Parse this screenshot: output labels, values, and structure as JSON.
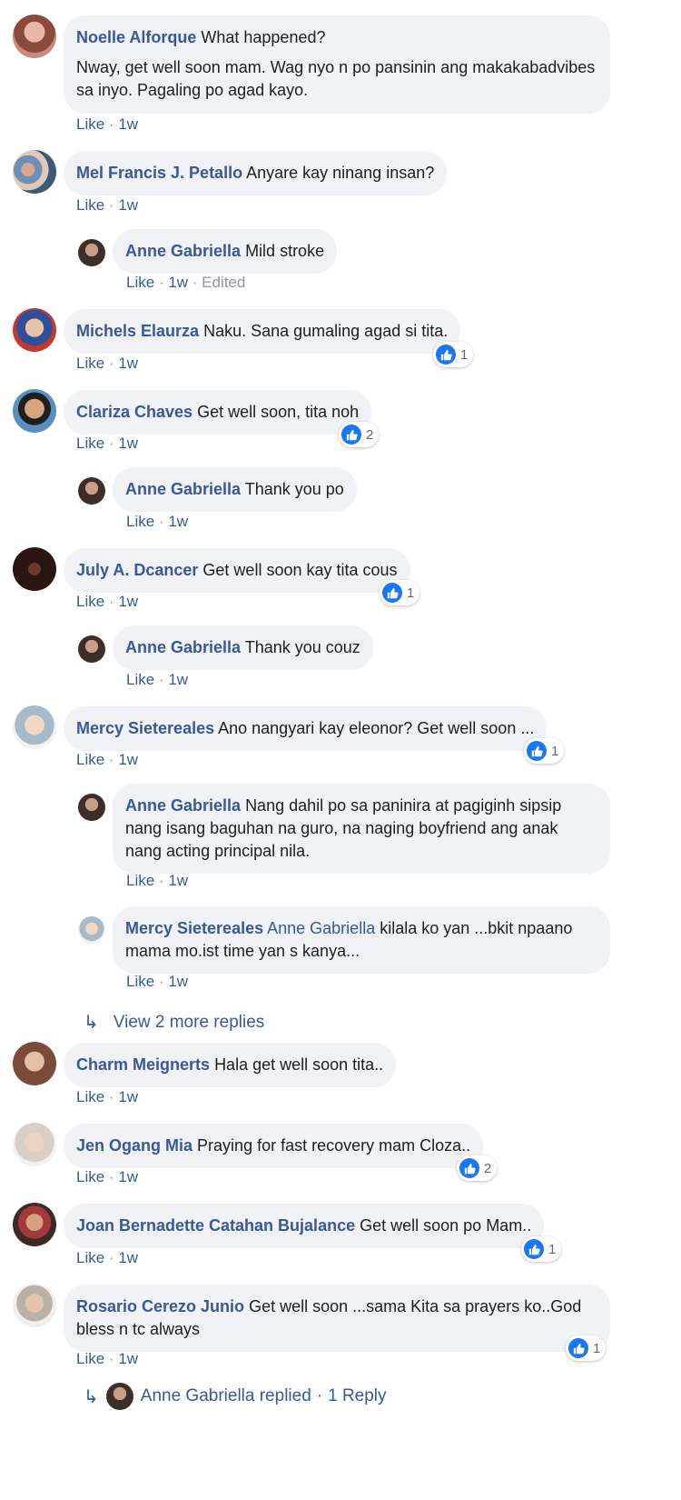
{
  "comments": [
    {
      "name": "Noelle Alforque",
      "text": "What happened?",
      "text2": "Nway, get well soon mam. Wag nyo n po pansinin ang makakabadvibes sa inyo. Pagaling po agad kayo.",
      "like": "Like",
      "time": "1w"
    },
    {
      "name": "Mel Francis J. Petallo",
      "text": "Anyare kay ninang insan?",
      "like": "Like",
      "time": "1w"
    },
    {
      "name": "Anne Gabriella",
      "text": "Mild stroke",
      "like": "Like",
      "time": "1w",
      "edited": "Edited"
    },
    {
      "name": "Michels Elaurza",
      "text": "Naku. Sana gumaling agad si tita.",
      "like": "Like",
      "time": "1w",
      "reactions": "1"
    },
    {
      "name": "Clariza Chaves",
      "text": "Get well soon, tita noh",
      "like": "Like",
      "time": "1w",
      "reactions": "2"
    },
    {
      "name": "Anne Gabriella",
      "text": "Thank you po",
      "like": "Like",
      "time": "1w"
    },
    {
      "name": "July A. Dcancer",
      "text": "Get well soon kay tita cous",
      "like": "Like",
      "time": "1w",
      "reactions": "1"
    },
    {
      "name": "Anne Gabriella",
      "text": "Thank you couz",
      "like": "Like",
      "time": "1w"
    },
    {
      "name": "Mercy Sietereales",
      "text": "Ano nangyari kay eleonor? Get well soon ...",
      "like": "Like",
      "time": "1w",
      "reactions": "1"
    },
    {
      "name": "Anne Gabriella",
      "text": "Nang dahil po sa paninira at pagiginh sipsip nang isang baguhan na guro, na naging boyfriend ang anak nang acting principal nila.",
      "like": "Like",
      "time": "1w"
    },
    {
      "name": "Mercy Sietereales",
      "tag": "Anne Gabriella",
      "text": "kilala ko yan ...bkit npaano mama mo.ist time yan s kanya...",
      "like": "Like",
      "time": "1w"
    },
    {
      "name": "Charm Meignerts",
      "text": "Hala get well soon tita..",
      "like": "Like",
      "time": "1w"
    },
    {
      "name": "Jen Ogang Mia",
      "text": "Praying for fast recovery mam Cloza..",
      "like": "Like",
      "time": "1w",
      "reactions": "2"
    },
    {
      "name": "Joan Bernadette Catahan Bujalance",
      "text": "Get well soon po Mam..",
      "like": "Like",
      "time": "1w",
      "reactions": "1"
    },
    {
      "name": "Rosario Cerezo Junio",
      "text": "Get well soon ...sama Kita sa prayers ko..God bless n tc always",
      "like": "Like",
      "time": "1w",
      "reactions": "1"
    }
  ],
  "view_more": "View 2 more replies",
  "replied": {
    "name": "Anne Gabriella replied",
    "sep": "·",
    "count": "1 Reply"
  },
  "separator": "·",
  "colors": {
    "link": "#385898",
    "bubble": "#f0f2f5",
    "like_blue": "#1877f2",
    "meta_gray": "#90949c"
  }
}
